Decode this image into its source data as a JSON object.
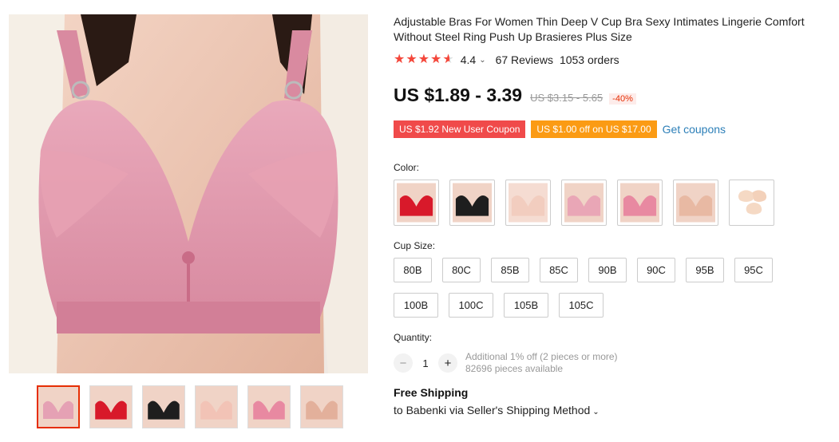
{
  "product": {
    "title": "Adjustable Bras For Women Thin Deep V Cup Bra Sexy Intimates Lingerie Comfort Without Steel Ring Push Up Brasieres Plus Size",
    "rating": "4.4",
    "rating_value": 4.4,
    "reviews": "67 Reviews",
    "orders": "1053 orders",
    "price": "US $1.89 - 3.39",
    "old_price": "US $3.15 - 5.65",
    "discount": "-40%"
  },
  "coupons": {
    "new_user": "US $1.92 New User Coupon",
    "threshold": "US $1.00 off on US $17.00",
    "get_link": "Get coupons"
  },
  "color": {
    "label": "Color:",
    "swatches": [
      {
        "name": "red",
        "hex": "#d8192a"
      },
      {
        "name": "black",
        "hex": "#1e1e1e"
      },
      {
        "name": "beige",
        "hex": "#f2cdbf"
      },
      {
        "name": "pink",
        "hex": "#e9a6b6"
      },
      {
        "name": "rose",
        "hex": "#e889a1"
      },
      {
        "name": "skin",
        "hex": "#e8b9a3"
      },
      {
        "name": "nipple-covers",
        "hex": "#f5d9c4"
      }
    ]
  },
  "cup_size": {
    "label": "Cup Size:",
    "options": [
      "80B",
      "80C",
      "85B",
      "85C",
      "90B",
      "90C",
      "95B",
      "95C",
      "100B",
      "100C",
      "105B",
      "105C"
    ]
  },
  "quantity": {
    "label": "Quantity:",
    "value": "1",
    "minus": "−",
    "plus": "+",
    "additional": "Additional 1% off (2 pieces or more)",
    "available": "82696 pieces available"
  },
  "shipping": {
    "title": "Free Shipping",
    "destination": "to Babenki via Seller's Shipping Method"
  },
  "gallery": {
    "thumbnails": [
      "pink",
      "red",
      "black",
      "beige",
      "rose",
      "skin"
    ]
  },
  "colors": {
    "accent_red": "#e62e04",
    "coupon_red": "#f04a4a",
    "coupon_orange": "#fb9b14",
    "link_blue": "#2c7fb8",
    "star": "#f4473b"
  }
}
